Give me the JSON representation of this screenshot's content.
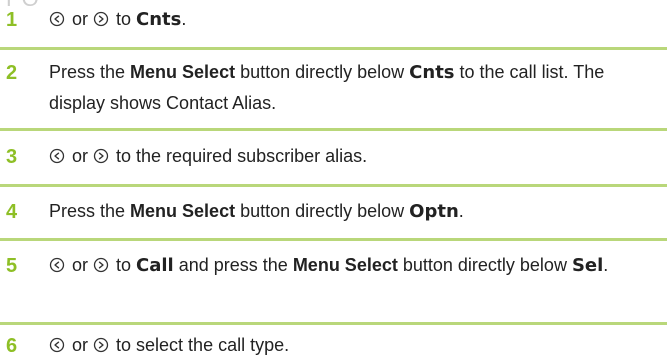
{
  "steps": [
    {
      "num": "1",
      "parts": [
        {
          "t": "icon",
          "name": "nav-left-icon"
        },
        {
          "t": "text",
          "v": " or "
        },
        {
          "t": "icon",
          "name": "nav-right-icon"
        },
        {
          "t": "text",
          "v": " to "
        },
        {
          "t": "dev",
          "v": "Cnts"
        },
        {
          "t": "text",
          "v": "."
        }
      ]
    },
    {
      "num": "2",
      "parts": [
        {
          "t": "text",
          "v": "Press the "
        },
        {
          "t": "bold",
          "v": "Menu Select"
        },
        {
          "t": "text",
          "v": " button directly below "
        },
        {
          "t": "dev",
          "v": "Cnts"
        },
        {
          "t": "text",
          "v": " to the call list. The display shows Contact Alias."
        }
      ]
    },
    {
      "num": "3",
      "parts": [
        {
          "t": "icon",
          "name": "nav-left-icon"
        },
        {
          "t": "text",
          "v": " or "
        },
        {
          "t": "icon",
          "name": "nav-right-icon"
        },
        {
          "t": "text",
          "v": " to the required subscriber alias."
        }
      ]
    },
    {
      "num": "4",
      "parts": [
        {
          "t": "text",
          "v": "Press the "
        },
        {
          "t": "bold",
          "v": "Menu Select"
        },
        {
          "t": "text",
          "v": " button directly below "
        },
        {
          "t": "dev",
          "v": "Optn"
        },
        {
          "t": "text",
          "v": "."
        }
      ]
    },
    {
      "num": "5",
      "parts": [
        {
          "t": "icon",
          "name": "nav-left-icon"
        },
        {
          "t": "text",
          "v": " or "
        },
        {
          "t": "icon",
          "name": "nav-right-icon"
        },
        {
          "t": "text",
          "v": " to "
        },
        {
          "t": "dev",
          "v": "Call"
        },
        {
          "t": "text",
          "v": " and press the "
        },
        {
          "t": "bold",
          "v": "Menu Select"
        },
        {
          "t": "text",
          "v": " button directly below "
        },
        {
          "t": "dev",
          "v": "Sel"
        },
        {
          "t": "text",
          "v": "."
        }
      ]
    },
    {
      "num": "6",
      "parts": [
        {
          "t": "icon",
          "name": "nav-left-icon"
        },
        {
          "t": "text",
          "v": " or "
        },
        {
          "t": "icon",
          "name": "nav-right-icon"
        },
        {
          "t": "text",
          "v": " to select the call type."
        }
      ]
    }
  ]
}
